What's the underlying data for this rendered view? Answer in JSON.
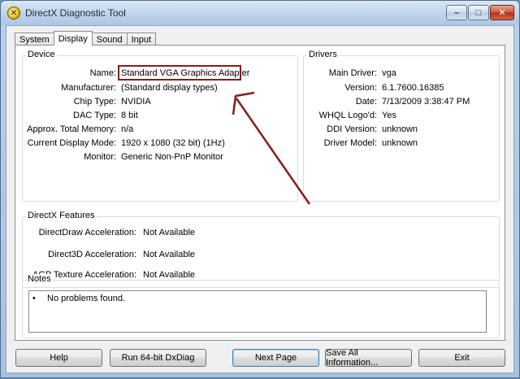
{
  "window": {
    "title": "DirectX Diagnostic Tool",
    "controls": {
      "minimize": "–",
      "maximize": "□",
      "close": "✕"
    }
  },
  "tabs": [
    {
      "label": "System"
    },
    {
      "label": "Display"
    },
    {
      "label": "Sound"
    },
    {
      "label": "Input"
    }
  ],
  "device": {
    "group_label": "Device",
    "rows": [
      {
        "label": "Name:",
        "value": "Standard VGA Graphics Adapter"
      },
      {
        "label": "Manufacturer:",
        "value": "(Standard display types)"
      },
      {
        "label": "Chip Type:",
        "value": "NVIDIA"
      },
      {
        "label": "DAC Type:",
        "value": "8 bit"
      },
      {
        "label": "Approx. Total Memory:",
        "value": "n/a"
      },
      {
        "label": "Current Display Mode:",
        "value": "1920 x 1080 (32 bit) (1Hz)"
      },
      {
        "label": "Monitor:",
        "value": "Generic Non-PnP Monitor"
      }
    ]
  },
  "drivers": {
    "group_label": "Drivers",
    "rows": [
      {
        "label": "Main Driver:",
        "value": "vga"
      },
      {
        "label": "Version:",
        "value": "6.1.7600.16385"
      },
      {
        "label": "Date:",
        "value": "7/13/2009 3:38:47 PM"
      },
      {
        "label": "WHQL Logo'd:",
        "value": "Yes"
      },
      {
        "label": "DDI Version:",
        "value": "unknown"
      },
      {
        "label": "Driver Model:",
        "value": "unknown"
      }
    ]
  },
  "features": {
    "group_label": "DirectX Features",
    "rows": [
      {
        "label": "DirectDraw Acceleration:",
        "value": "Not Available"
      },
      {
        "label": "Direct3D Acceleration:",
        "value": "Not Available"
      },
      {
        "label": "AGP Texture Acceleration:",
        "value": "Not Available"
      }
    ]
  },
  "notes": {
    "group_label": "Notes",
    "items": [
      "No problems found."
    ]
  },
  "buttons": {
    "help": "Help",
    "run64": "Run 64-bit DxDiag",
    "next": "Next Page",
    "save": "Save All Information...",
    "exit": "Exit"
  },
  "colors": {
    "annotation": "#8b1a1a"
  }
}
